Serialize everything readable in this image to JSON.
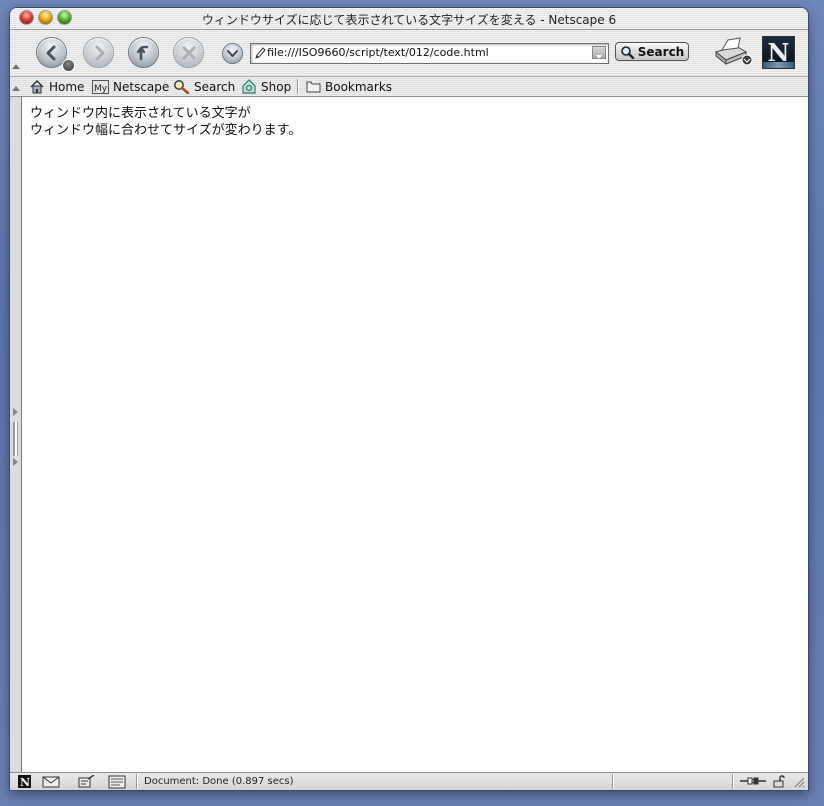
{
  "window": {
    "title": "ウィンドウサイズに応じて表示されている文字サイズを変える - Netscape 6"
  },
  "toolbar": {
    "url": "file:///ISO9660/script/text/012/code.html",
    "search_label": "Search"
  },
  "personal_toolbar": {
    "items": [
      {
        "label": "Home",
        "icon": "home-icon"
      },
      {
        "label": "Netscape",
        "icon": "my-netscape-icon"
      },
      {
        "label": "Search",
        "icon": "magnifier-icon"
      },
      {
        "label": "Shop",
        "icon": "shop-icon"
      },
      {
        "label": "Bookmarks",
        "icon": "folder-icon"
      }
    ]
  },
  "page": {
    "line1": "ウィンドウ内に表示されている文字が",
    "line2": "ウィンドウ幅に合わせてサイズが変わります。"
  },
  "status": {
    "text": "Document: Done (0.897 secs)"
  }
}
